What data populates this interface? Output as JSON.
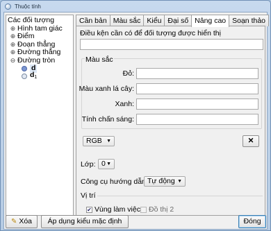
{
  "window": {
    "title": "Thuộc tính"
  },
  "tree": {
    "root": "Các đối tượng",
    "groups": [
      "Hình tam giác",
      "Điểm",
      "Đoạn thẳng",
      "Đường thẳng",
      "Đường tròn"
    ],
    "items": [
      {
        "name": "d",
        "sub": ""
      },
      {
        "name": "d",
        "sub": "1"
      }
    ]
  },
  "tabs": [
    "Cần bản",
    "Màu sắc",
    "Kiểu",
    "Đại số",
    "Nâng cao",
    "Soạn thảo"
  ],
  "active_tab": "Nâng cao",
  "advanced": {
    "condition_label": "Điều kện cần có để đối tượng được hiển thị",
    "color_section": "Màu sắc",
    "red_label": "Đỏ:",
    "green_label": "Màu xanh lá cây:",
    "blue_label": "Xanh:",
    "opacity_label": "Tính chấn sáng:",
    "color_mode": "RGB",
    "clear_button": "✕",
    "layer_label": "Lớp:",
    "layer_value": "0",
    "tooltip_label": "Công cụ hướng dẫn:",
    "tooltip_value": "Tự động",
    "position_label": "Vị trí",
    "graphics_label": "Vùng làm việc",
    "graphics_checked": true,
    "graphics2_label": "Đồ thị 2",
    "graphics2_checked": false
  },
  "buttons": {
    "delete": "Xóa",
    "apply_style": "Áp dụng kiểu mặc định",
    "close": "Đóng"
  },
  "icons": {
    "delete": "eraser-icon",
    "app": "geogebra-icon"
  }
}
